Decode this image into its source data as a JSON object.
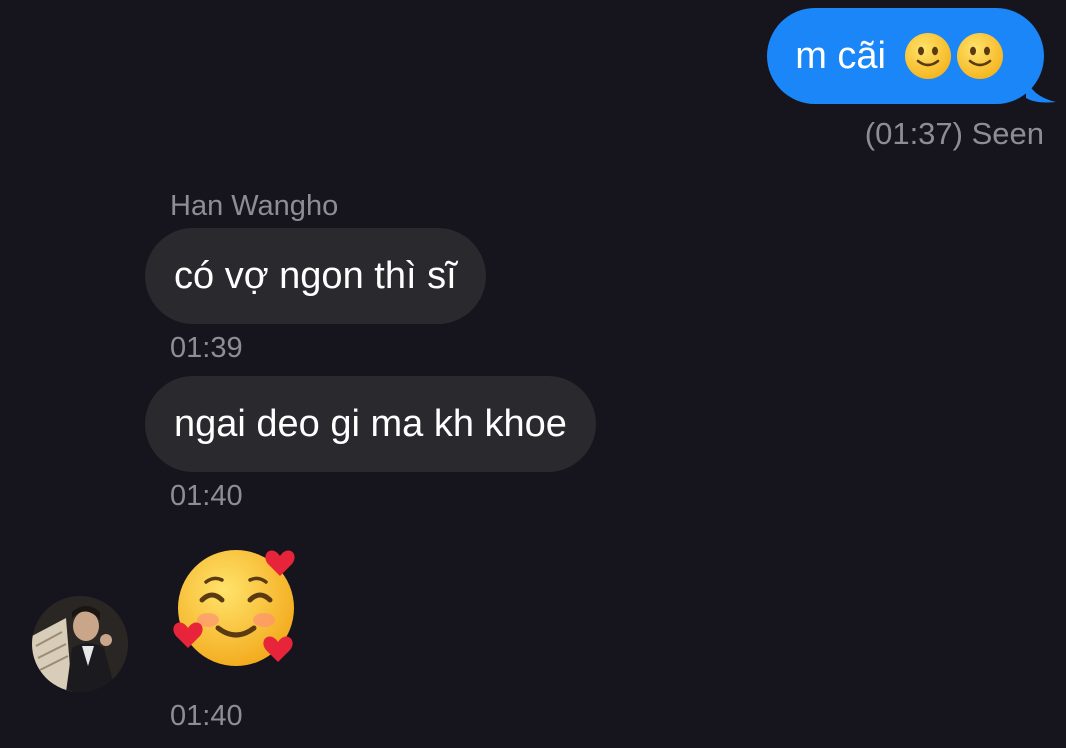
{
  "outgoing": {
    "text": "m cãi",
    "emojis": [
      "slightly-smiling-face-emoji",
      "slightly-smiling-face-emoji"
    ],
    "status": "(01:37) Seen"
  },
  "incoming": {
    "sender": "Han Wangho",
    "messages": [
      {
        "text": "có vợ ngon thì sĩ",
        "time": "01:39"
      },
      {
        "text": "ngai deo gi ma kh khoe",
        "time": "01:40"
      },
      {
        "emoji": "smiling-face-with-hearts-emoji",
        "time": "01:40"
      }
    ]
  },
  "colors": {
    "background": "#16141c",
    "outgoing_bubble": "#1b86f7",
    "incoming_bubble": "#2a292e",
    "meta_text": "#8e8d95"
  }
}
